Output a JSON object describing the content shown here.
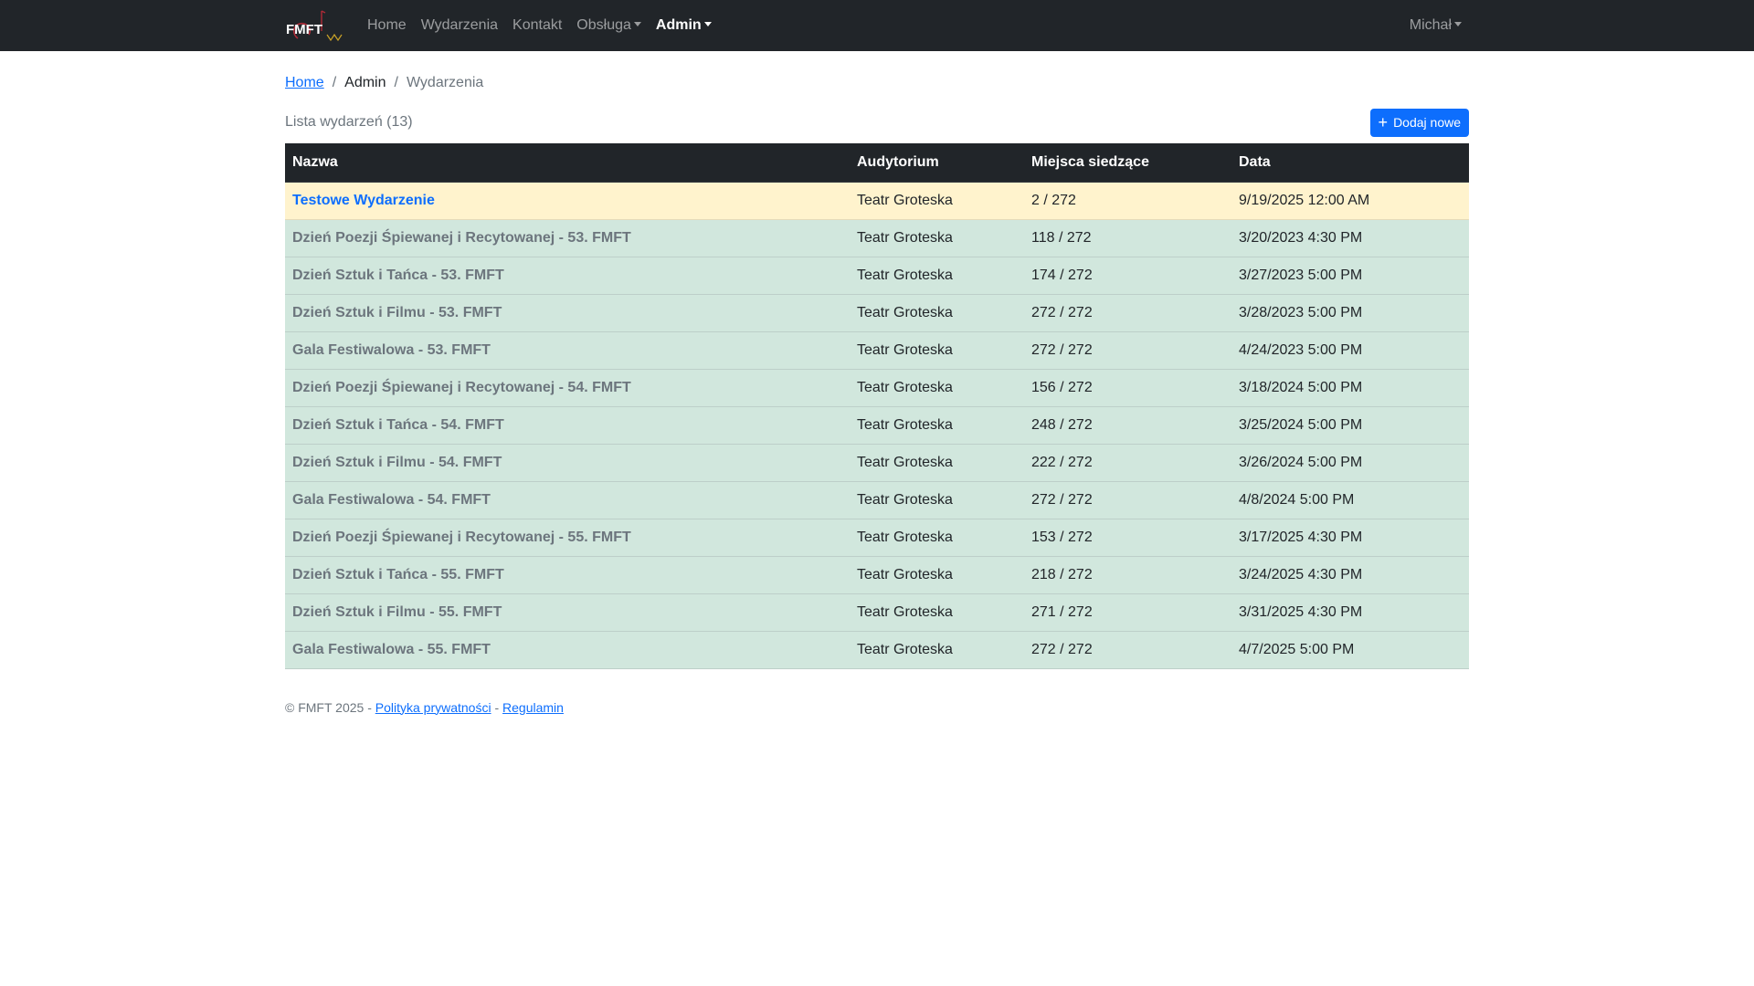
{
  "navbar": {
    "logo_text": "FMFT",
    "items": [
      {
        "label": "Home"
      },
      {
        "label": "Wydarzenia"
      },
      {
        "label": "Kontakt"
      },
      {
        "label": "Obsługa"
      },
      {
        "label": "Admin"
      }
    ],
    "user": "Michał"
  },
  "breadcrumb": {
    "home": "Home",
    "admin": "Admin",
    "current": "Wydarzenia",
    "separator": "/"
  },
  "list": {
    "title": "Lista wydarzeń (13)",
    "add_button": "Dodaj nowe",
    "add_icon": "plus-icon"
  },
  "table": {
    "headers": [
      "Nazwa",
      "Audytorium",
      "Miejsca siedzące",
      "Data"
    ],
    "rows": [
      {
        "name": "Testowe Wydarzenie",
        "auditorium": "Teatr Groteska",
        "seats": "2 / 272",
        "date": "9/19/2025 12:00 AM"
      },
      {
        "name": "Dzień Poezji Śpiewanej i Recytowanej - 53. FMFT",
        "auditorium": "Teatr Groteska",
        "seats": "118 / 272",
        "date": "3/20/2023 4:30 PM"
      },
      {
        "name": "Dzień Sztuk i Tańca - 53. FMFT",
        "auditorium": "Teatr Groteska",
        "seats": "174 / 272",
        "date": "3/27/2023 5:00 PM"
      },
      {
        "name": "Dzień Sztuk i Filmu - 53. FMFT",
        "auditorium": "Teatr Groteska",
        "seats": "272 / 272",
        "date": "3/28/2023 5:00 PM"
      },
      {
        "name": "Gala Festiwalowa - 53. FMFT",
        "auditorium": "Teatr Groteska",
        "seats": "272 / 272",
        "date": "4/24/2023 5:00 PM"
      },
      {
        "name": "Dzień Poezji Śpiewanej i Recytowanej - 54. FMFT",
        "auditorium": "Teatr Groteska",
        "seats": "156 / 272",
        "date": "3/18/2024 5:00 PM"
      },
      {
        "name": "Dzień Sztuk i Tańca - 54. FMFT",
        "auditorium": "Teatr Groteska",
        "seats": "248 / 272",
        "date": "3/25/2024 5:00 PM"
      },
      {
        "name": "Dzień Sztuk i Filmu - 54. FMFT",
        "auditorium": "Teatr Groteska",
        "seats": "222 / 272",
        "date": "3/26/2024 5:00 PM"
      },
      {
        "name": "Gala Festiwalowa - 54. FMFT",
        "auditorium": "Teatr Groteska",
        "seats": "272 / 272",
        "date": "4/8/2024 5:00 PM"
      },
      {
        "name": "Dzień Poezji Śpiewanej i Recytowanej - 55. FMFT",
        "auditorium": "Teatr Groteska",
        "seats": "153 / 272",
        "date": "3/17/2025 4:30 PM"
      },
      {
        "name": "Dzień Sztuk i Tańca - 55. FMFT",
        "auditorium": "Teatr Groteska",
        "seats": "218 / 272",
        "date": "3/24/2025 4:30 PM"
      },
      {
        "name": "Dzień Sztuk i Filmu - 55. FMFT",
        "auditorium": "Teatr Groteska",
        "seats": "271 / 272",
        "date": "3/31/2025 4:30 PM"
      },
      {
        "name": "Gala Festiwalowa - 55. FMFT",
        "auditorium": "Teatr Groteska",
        "seats": "272 / 272",
        "date": "4/7/2025 5:00 PM"
      }
    ]
  },
  "footer": {
    "copyright": "© FMFT 2025 -",
    "privacy": "Polityka prywatności",
    "sep": "-",
    "terms": "Regulamin"
  },
  "colors": {
    "navbar_bg": "#212529",
    "primary": "#0d6efd",
    "row_success": "#d1e7dd",
    "row_warning": "#fff3cd"
  }
}
